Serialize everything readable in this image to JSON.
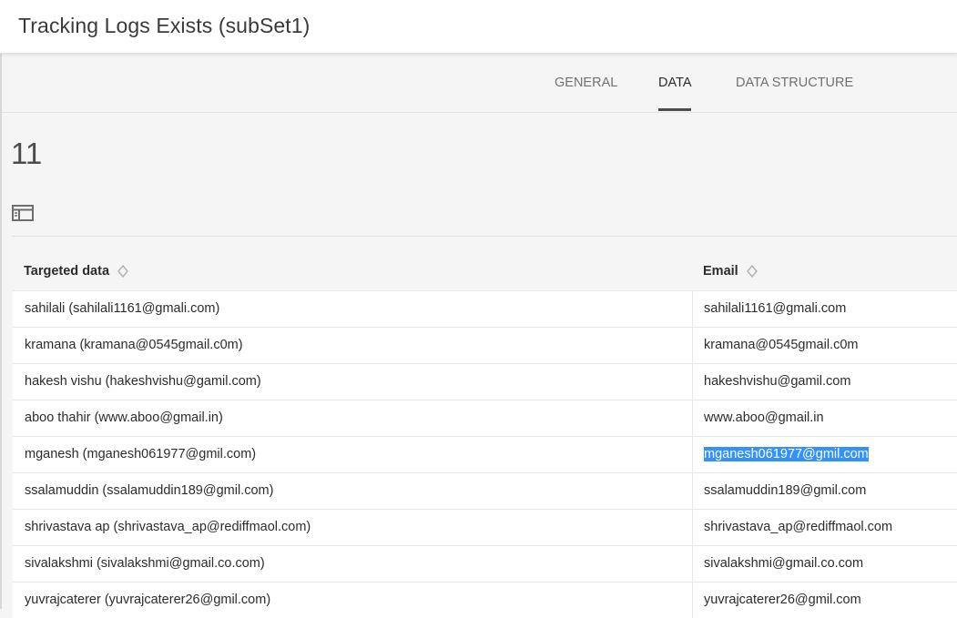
{
  "window": {
    "title": "Tracking Logs Exists (subSet1)"
  },
  "tabs": [
    {
      "label": "GENERAL",
      "active": false
    },
    {
      "label": "DATA",
      "active": true
    },
    {
      "label": "DATA STRUCTURE",
      "active": false
    }
  ],
  "summary": {
    "count": "11"
  },
  "table": {
    "columns": [
      "Targeted data",
      "Email"
    ],
    "rows": [
      [
        "sahilali (sahilali1161@gmali.com)",
        "sahilali1161@gmali.com"
      ],
      [
        "kramana (kramana@0545gmail.c0m)",
        "kramana@0545gmail.c0m"
      ],
      [
        "hakesh vishu (hakeshvishu@gamil.com)",
        "hakeshvishu@gamil.com"
      ],
      [
        "aboo thahir (www.aboo@gmail.in)",
        "www.aboo@gmail.in"
      ],
      [
        "mganesh (mganesh061977@gmil.com)",
        "mganesh061977@gmil.com"
      ],
      [
        "ssalamuddin (ssalamuddin189@gmil.com)",
        "ssalamuddin189@gmil.com"
      ],
      [
        "shrivastava ap (shrivastava_ap@rediffmaol.com)",
        "shrivastava_ap@rediffmaol.com"
      ],
      [
        "sivalakshmi (sivalakshmi@gmail.co.com)",
        "sivalakshmi@gmail.co.com"
      ],
      [
        "yuvrajcaterer (yuvrajcaterer26@gmil.com)",
        "yuvrajcaterer26@gmil.com"
      ]
    ],
    "selected_cell": {
      "row": 4,
      "column": 1
    }
  },
  "icons": {
    "panel_toggle": "sidebar-toggle-icon",
    "sort": "sort-diamond-icon"
  },
  "colors": {
    "selection": "#3390ff",
    "active_tab_underline": "#4b4b4b"
  }
}
